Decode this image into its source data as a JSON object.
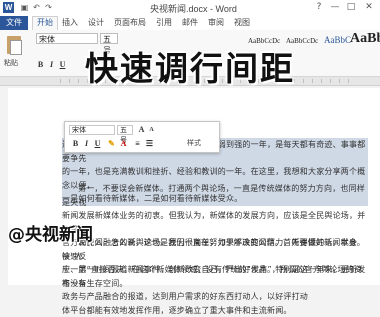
{
  "app": {
    "logo_letter": "W",
    "window_title": "央视新闻.docx - Word",
    "quick_access": [
      "save-icon",
      "undo-icon",
      "redo-icon"
    ],
    "window_controls": [
      "?",
      "—",
      "□",
      "✕"
    ]
  },
  "tabs": {
    "file": "文件",
    "items": [
      "开始",
      "插入",
      "设计",
      "页面布局",
      "引用",
      "邮件",
      "审阅",
      "视图"
    ],
    "active_index": 0
  },
  "ribbon": {
    "paste_label": "粘贴",
    "font_name": "宋体",
    "font_size": "五号",
    "format_buttons": [
      "B",
      "I",
      "U"
    ],
    "styles": [
      "AaBbCcDc",
      "AaBbCcDc",
      "AaBbC",
      "AaBb"
    ]
  },
  "overlay": {
    "title": "快速调行间距"
  },
  "mini_toolbar": {
    "font": "宋体",
    "size": "五号",
    "buttons": [
      "A",
      "A",
      "B",
      "I",
      "U"
    ],
    "style_label": "样式"
  },
  "document": {
    "paragraphs": [
      {
        "selected": true,
        "lines": [
          "过去一年，是央视新闻新媒体从无到有、由弱到强的一年，是每天都有奇迹、事事都要争先",
          "的一年，也是充满教训和挫折、经验和教训的一年。在这里，我想和大家分享两个概念以便，",
          "一是如何看待新媒体，二是如何看待新媒体受众。"
        ]
      },
      {
        "selected": false,
        "lines": [
          "第一，不要误会新媒体。打通两个舆论场，一直是传统媒体的努力方向，也同样是央视",
          "新闻发展新媒体业务的初衷。但我认为，新媒体的发展方向，应该是全民舆论场，并不是",
          "官方和民间融合的新舆论场。原因很简单，如果不改变公信力，听得懂的话，就会被“人",
          "干一层”直接否决，在这个新媒体领域，没有传统的“发声”，所谓的官方舆论场的资格没有生存空间。"
        ]
      },
      {
        "selected": false,
        "lines": [
          "说什么，怎么说，这也是我们一直在努力于解决的问题。首先要做好新闻本身。快速反",
          "应、第一时间报道新闻事件，创新改变自己，严出好作品。特别是这一年来，更新发布一条",
          "政务与产品融合的报道，达到用户需求的好东西打动人，以好评打动",
          "体平台都能有效地发挥作用，逐步确立了重大事件和主流新闻。"
        ]
      }
    ]
  },
  "watermark": {
    "text": "@央视新闻"
  }
}
